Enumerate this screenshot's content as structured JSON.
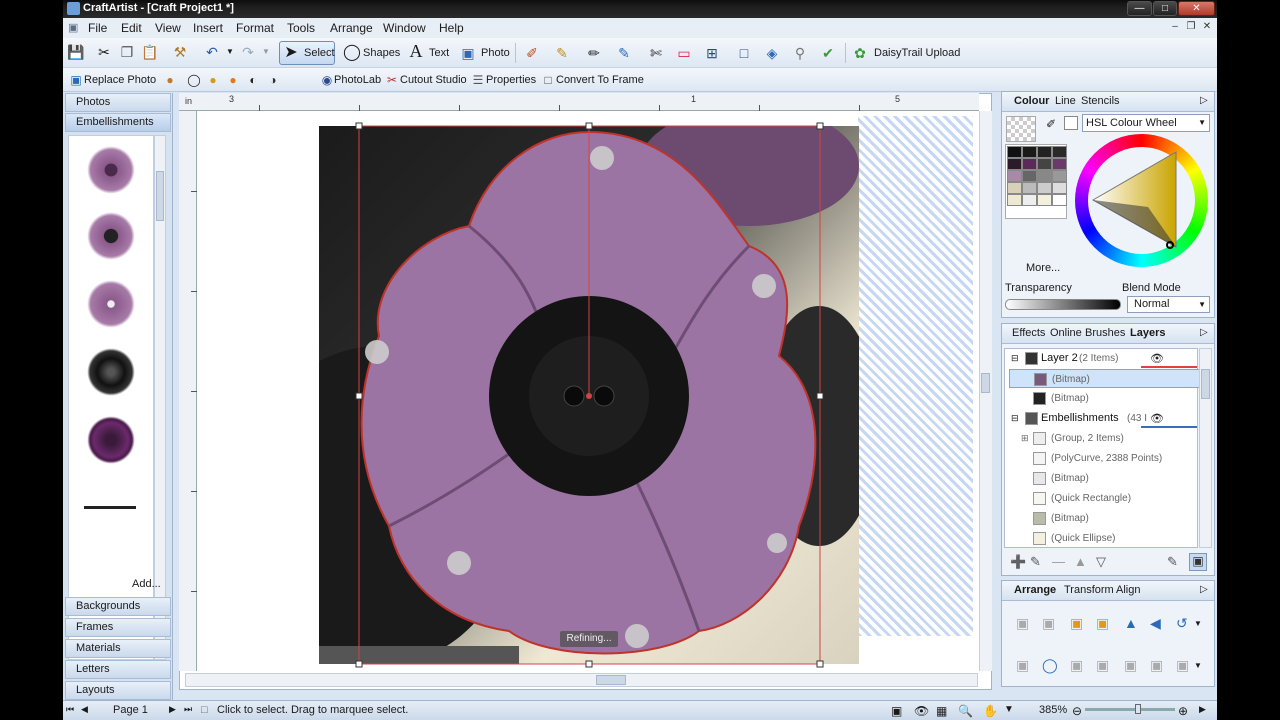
{
  "app": {
    "title": "CraftArtist - [Craft Project1 *]"
  },
  "menu": [
    "File",
    "Edit",
    "View",
    "Insert",
    "Format",
    "Tools",
    "Arrange",
    "Window",
    "Help"
  ],
  "toolbar": {
    "select_label": "Select",
    "shapes_label": "Shapes",
    "text_label": "Text",
    "photo_label": "Photo",
    "daisytrail_label": "DaisyTrail Upload"
  },
  "context_toolbar": {
    "replace_photo": "Replace Photo",
    "photolab": "PhotoLab",
    "cutout_studio": "Cutout Studio",
    "properties": "Properties",
    "convert_to_frame": "Convert To Frame"
  },
  "left_panel": {
    "tabs_top": [
      "Photos",
      "Embellishments"
    ],
    "tabs_bottom": [
      "Backgrounds",
      "Frames",
      "Materials",
      "Letters",
      "Layouts"
    ],
    "add_label": "Add..."
  },
  "ruler": {
    "unit": "in",
    "labels": [
      "3",
      "1",
      "5"
    ]
  },
  "canvas": {
    "refining": "Refining..."
  },
  "colour_panel": {
    "tabs": [
      "Colour",
      "Line",
      "Stencils"
    ],
    "model": "HSL Colour Wheel",
    "more": "More...",
    "transparency": "Transparency",
    "blend_mode": "Blend Mode",
    "blend_value": "Normal"
  },
  "layers_panel": {
    "tabs": [
      "Effects",
      "Online",
      "Brushes",
      "Layers"
    ],
    "rows": [
      {
        "label": "Layer 2",
        "extra": "(2 Items)"
      },
      {
        "label": "(Bitmap)"
      },
      {
        "label": "(Bitmap)"
      },
      {
        "label": "Embellishments",
        "extra": "(43 I"
      },
      {
        "label": "(Group, 2 Items)"
      },
      {
        "label": "(PolyCurve, 2388 Points)"
      },
      {
        "label": "(Bitmap)"
      },
      {
        "label": "(Quick Rectangle)"
      },
      {
        "label": "(Bitmap)"
      },
      {
        "label": "(Quick Ellipse)"
      }
    ]
  },
  "arrange_panel": {
    "tabs": [
      "Arrange",
      "Transform",
      "Align"
    ]
  },
  "status": {
    "page": "Page 1",
    "hint": "Click to select. Drag to marquee select.",
    "zoom": "385%"
  },
  "colors": {
    "accent": "#3a6fb8",
    "selection": "#cfe3fa"
  }
}
